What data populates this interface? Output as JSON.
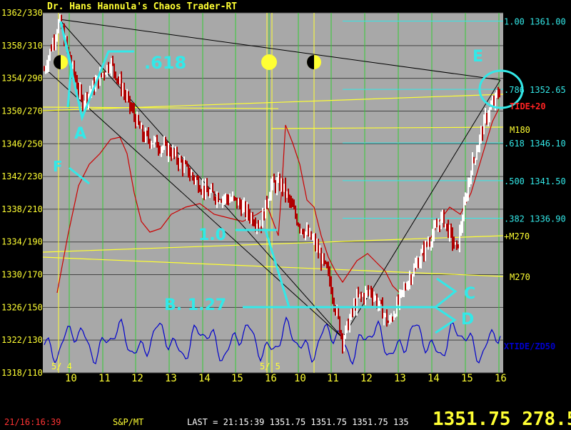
{
  "window": {
    "title": "Dr. Hans Hannula's Chaos Trader-RT"
  },
  "colors": {
    "plot_bg": "#a8a8a8",
    "price_up": "#ffffff",
    "price_down": "#b00000",
    "grid_v": "#33cc33",
    "grid_h": "#444444",
    "fib": "#33e8e8",
    "cyan_annot": "#33e8e8",
    "yellow": "#ffff33",
    "oscillator": "#0000cc",
    "red_line": "#cc0000",
    "trendline": "#000000"
  },
  "status": {
    "time": "21/16:16:39",
    "symbol": "S&P/MT",
    "last_line": "LAST = 21:15:39 1351.75 1351.75 1351.75 135",
    "big_price": "1351.75 278.5"
  },
  "chart_data": {
    "type": "candlestick",
    "title": "Dr. Hans Hannula's Chaos Trader-RT",
    "y_axis": {
      "range": [
        1318,
        1362
      ],
      "tick_labels": [
        "1362/330",
        "1358/310",
        "1354/290",
        "1350/270",
        "1346/250",
        "1342/230",
        "1338/210",
        "1334/190",
        "1330/170",
        "1326/150",
        "1322/130",
        "1318/110"
      ],
      "tick_values": [
        1362,
        1358,
        1354,
        1350,
        1346,
        1342,
        1338,
        1334,
        1330,
        1326,
        1322,
        1318
      ]
    },
    "x_axis": {
      "tick_labels": [
        "10",
        "11",
        "12",
        "13",
        "14",
        "15",
        "16",
        "10",
        "11",
        "12",
        "13",
        "14",
        "15",
        "16"
      ],
      "date_labels": [
        "5/ 4",
        "5/ 5"
      ]
    },
    "fib_levels": [
      {
        "label": "1.00",
        "value": 1361.0
      },
      {
        "label": ".786",
        "value": 1352.65
      },
      {
        "label": ".618",
        "value": 1346.1
      },
      {
        "label": ".500",
        "value": 1341.5
      },
      {
        "label": ".382",
        "value": 1336.9
      }
    ],
    "right_labels": [
      "TIDE+20",
      "M180",
      "+M270",
      "M270",
      "XTIDE/ZD50"
    ],
    "annotations": [
      "A",
      "F",
      ".618",
      "1.0",
      "B. 1.27",
      "C",
      "D",
      "E"
    ],
    "moon_phases": [
      "first-quarter",
      "full",
      "last-quarter"
    ],
    "key_prices": {
      "start_high": 1361.0,
      "low": 1322.0,
      "end_high": 1352.65
    }
  }
}
